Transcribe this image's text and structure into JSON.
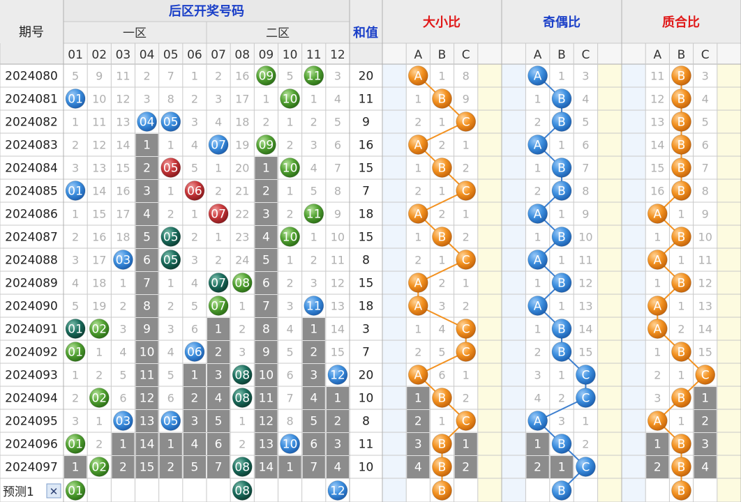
{
  "header": {
    "period_label": "期号",
    "main_title": "后区开奖号码",
    "zone1_label": "一区",
    "zone2_label": "二区",
    "sum_label": "和值",
    "big_small_label": "大小比",
    "odd_even_label": "奇偶比",
    "prime_comp_label": "质合比",
    "sub_cols": [
      "A",
      "B",
      "C"
    ],
    "numbers": [
      "01",
      "02",
      "03",
      "04",
      "05",
      "06",
      "07",
      "08",
      "09",
      "10",
      "11",
      "12"
    ]
  },
  "predict": {
    "label": "预测1",
    "close_glyph": "✕"
  },
  "colors": {
    "blue_ball": "#3d8fdf",
    "red_ball": "#c8373a",
    "green_ball": "#52a232",
    "teal_ball": "#1b6e5e",
    "orange_ball": "#f39221",
    "gray_cell": "#8c8c8c",
    "header_text": "#1a3fc8",
    "red_header_text": "#e01818",
    "blue_line": "#3d7fcf",
    "orange_line": "#f39221"
  },
  "chart_data": {
    "type": "table",
    "periods": [
      "2024080",
      "2024081",
      "2024082",
      "2024083",
      "2024084",
      "2024085",
      "2024086",
      "2024087",
      "2024088",
      "2024089",
      "2024090",
      "2024091",
      "2024092",
      "2024093",
      "2024094",
      "2024095",
      "2024096",
      "2024097"
    ],
    "cells": [
      [
        "5",
        "9",
        "11",
        "2",
        "7",
        "1",
        "2",
        "16",
        "09",
        "5",
        "11",
        "3"
      ],
      [
        "01",
        "10",
        "12",
        "3",
        "8",
        "2",
        "3",
        "17",
        "1",
        "10",
        "1",
        "4"
      ],
      [
        "1",
        "11",
        "13",
        "04",
        "05",
        "3",
        "4",
        "18",
        "2",
        "1",
        "2",
        "5"
      ],
      [
        "2",
        "12",
        "14",
        "1",
        "1",
        "4",
        "07",
        "19",
        "09",
        "2",
        "3",
        "6"
      ],
      [
        "3",
        "13",
        "15",
        "2",
        "05",
        "5",
        "1",
        "20",
        "1",
        "10",
        "4",
        "7"
      ],
      [
        "01",
        "14",
        "16",
        "3",
        "1",
        "06",
        "2",
        "21",
        "2",
        "1",
        "5",
        "8"
      ],
      [
        "1",
        "15",
        "17",
        "4",
        "2",
        "1",
        "07",
        "22",
        "3",
        "2",
        "11",
        "9"
      ],
      [
        "2",
        "16",
        "18",
        "5",
        "05",
        "2",
        "1",
        "23",
        "4",
        "10",
        "1",
        "10"
      ],
      [
        "3",
        "17",
        "03",
        "6",
        "05",
        "3",
        "2",
        "24",
        "5",
        "1",
        "2",
        "11"
      ],
      [
        "4",
        "18",
        "1",
        "7",
        "1",
        "4",
        "07",
        "08",
        "6",
        "2",
        "3",
        "12"
      ],
      [
        "5",
        "19",
        "2",
        "8",
        "2",
        "5",
        "07",
        "1",
        "7",
        "3",
        "11",
        "13"
      ],
      [
        "01",
        "02",
        "3",
        "9",
        "3",
        "6",
        "1",
        "2",
        "8",
        "4",
        "1",
        "14"
      ],
      [
        "01",
        "1",
        "4",
        "10",
        "4",
        "06",
        "2",
        "3",
        "9",
        "5",
        "2",
        "15"
      ],
      [
        "1",
        "2",
        "5",
        "11",
        "5",
        "1",
        "3",
        "08",
        "10",
        "6",
        "3",
        "12"
      ],
      [
        "2",
        "02",
        "6",
        "12",
        "6",
        "2",
        "4",
        "08",
        "11",
        "7",
        "4",
        "1"
      ],
      [
        "3",
        "1",
        "03",
        "13",
        "05",
        "3",
        "5",
        "1",
        "12",
        "8",
        "5",
        "2"
      ],
      [
        "01",
        "2",
        "1",
        "14",
        "1",
        "4",
        "6",
        "2",
        "13",
        "10",
        "6",
        "3"
      ],
      [
        "1",
        "02",
        "2",
        "15",
        "2",
        "5",
        "7",
        "08",
        "14",
        "1",
        "7",
        "4"
      ]
    ],
    "styles": [
      [
        "n",
        "n",
        "n",
        "n",
        "n",
        "n",
        "n",
        "n",
        "G",
        "n",
        "G",
        "n"
      ],
      [
        "B",
        "n",
        "n",
        "n",
        "n",
        "n",
        "n",
        "n",
        "n",
        "G",
        "n",
        "n"
      ],
      [
        "n",
        "n",
        "n",
        "B",
        "B",
        "n",
        "n",
        "n",
        "n",
        "n",
        "n",
        "n"
      ],
      [
        "n",
        "n",
        "n",
        "g",
        "n",
        "n",
        "B",
        "n",
        "G",
        "n",
        "n",
        "n"
      ],
      [
        "n",
        "n",
        "n",
        "g",
        "R",
        "n",
        "n",
        "n",
        "g",
        "G",
        "n",
        "n"
      ],
      [
        "B",
        "n",
        "n",
        "g",
        "n",
        "R",
        "n",
        "n",
        "g",
        "n",
        "n",
        "n"
      ],
      [
        "n",
        "n",
        "n",
        "g",
        "n",
        "n",
        "R",
        "n",
        "g",
        "n",
        "G",
        "n"
      ],
      [
        "n",
        "n",
        "n",
        "g",
        "T",
        "n",
        "n",
        "n",
        "g",
        "G",
        "n",
        "n"
      ],
      [
        "n",
        "n",
        "B",
        "g",
        "T",
        "n",
        "n",
        "n",
        "g",
        "n",
        "n",
        "n"
      ],
      [
        "n",
        "n",
        "n",
        "g",
        "n",
        "n",
        "T",
        "G",
        "g",
        "n",
        "n",
        "n"
      ],
      [
        "n",
        "n",
        "n",
        "g",
        "n",
        "n",
        "G",
        "n",
        "g",
        "n",
        "B",
        "n"
      ],
      [
        "T",
        "G",
        "n",
        "g",
        "n",
        "n",
        "g",
        "n",
        "g",
        "n",
        "g",
        "n"
      ],
      [
        "G",
        "n",
        "n",
        "g",
        "n",
        "B",
        "g",
        "n",
        "g",
        "n",
        "g",
        "n"
      ],
      [
        "n",
        "n",
        "n",
        "g",
        "n",
        "g",
        "g",
        "T",
        "g",
        "n",
        "g",
        "B"
      ],
      [
        "n",
        "G",
        "n",
        "g",
        "n",
        "g",
        "g",
        "T",
        "g",
        "n",
        "g",
        "g"
      ],
      [
        "n",
        "n",
        "B",
        "g",
        "B",
        "g",
        "g",
        "n",
        "g",
        "n",
        "g",
        "g"
      ],
      [
        "G",
        "n",
        "g",
        "g",
        "g",
        "g",
        "g",
        "n",
        "g",
        "B",
        "g",
        "g"
      ],
      [
        "g",
        "G",
        "g",
        "g",
        "g",
        "g",
        "g",
        "T",
        "g",
        "g",
        "g",
        "g"
      ]
    ],
    "sums": [
      "20",
      "11",
      "9",
      "16",
      "15",
      "7",
      "18",
      "15",
      "8",
      "15",
      "18",
      "3",
      "7",
      "20",
      "10",
      "8",
      "11",
      "10"
    ],
    "big_small": [
      [
        "A",
        "1",
        "8"
      ],
      [
        "1",
        "B",
        "9"
      ],
      [
        "2",
        "1",
        "C"
      ],
      [
        "A",
        "2",
        "1"
      ],
      [
        "1",
        "B",
        "2"
      ],
      [
        "2",
        "1",
        "C"
      ],
      [
        "A",
        "2",
        "1"
      ],
      [
        "1",
        "B",
        "2"
      ],
      [
        "2",
        "1",
        "C"
      ],
      [
        "A",
        "2",
        "1"
      ],
      [
        "A",
        "3",
        "2"
      ],
      [
        "1",
        "4",
        "C"
      ],
      [
        "2",
        "5",
        "C"
      ],
      [
        "A",
        "6",
        "1"
      ],
      [
        "1",
        "B",
        "2"
      ],
      [
        "2",
        "1",
        "C"
      ],
      [
        "3",
        "B",
        "1"
      ],
      [
        "4",
        "B",
        "2"
      ]
    ],
    "big_small_pick": [
      0,
      1,
      2,
      0,
      1,
      2,
      0,
      1,
      2,
      0,
      0,
      2,
      2,
      0,
      1,
      2,
      1,
      1
    ],
    "big_small_gray": [
      [],
      [],
      [],
      [],
      [],
      [],
      [],
      [],
      [],
      [],
      [],
      [],
      [],
      [],
      [
        0
      ],
      [
        0
      ],
      [
        0,
        2
      ],
      [
        0,
        2
      ]
    ],
    "odd_even": [
      [
        "A",
        "1",
        "3"
      ],
      [
        "1",
        "B",
        "4"
      ],
      [
        "2",
        "B",
        "5"
      ],
      [
        "A",
        "1",
        "6"
      ],
      [
        "1",
        "B",
        "7"
      ],
      [
        "2",
        "B",
        "8"
      ],
      [
        "A",
        "1",
        "9"
      ],
      [
        "1",
        "B",
        "10"
      ],
      [
        "A",
        "1",
        "11"
      ],
      [
        "1",
        "B",
        "12"
      ],
      [
        "A",
        "1",
        "13"
      ],
      [
        "1",
        "B",
        "14"
      ],
      [
        "2",
        "B",
        "15"
      ],
      [
        "3",
        "1",
        "C"
      ],
      [
        "4",
        "2",
        "C"
      ],
      [
        "A",
        "3",
        "1"
      ],
      [
        "1",
        "B",
        "2"
      ],
      [
        "2",
        "1",
        "C"
      ]
    ],
    "odd_even_pick": [
      0,
      1,
      1,
      0,
      1,
      1,
      0,
      1,
      0,
      1,
      0,
      1,
      1,
      2,
      2,
      0,
      1,
      2
    ],
    "odd_even_gray": [
      [],
      [],
      [],
      [],
      [],
      [],
      [],
      [],
      [],
      [],
      [],
      [],
      [],
      [],
      [],
      [],
      [
        0
      ],
      [
        0,
        1
      ]
    ],
    "prime_comp": [
      [
        "11",
        "B",
        "3"
      ],
      [
        "12",
        "B",
        "4"
      ],
      [
        "13",
        "B",
        "5"
      ],
      [
        "14",
        "B",
        "6"
      ],
      [
        "15",
        "B",
        "7"
      ],
      [
        "16",
        "B",
        "8"
      ],
      [
        "A",
        "1",
        "9"
      ],
      [
        "1",
        "B",
        "10"
      ],
      [
        "A",
        "1",
        "11"
      ],
      [
        "1",
        "B",
        "12"
      ],
      [
        "A",
        "1",
        "13"
      ],
      [
        "A",
        "2",
        "14"
      ],
      [
        "1",
        "B",
        "15"
      ],
      [
        "2",
        "1",
        "C"
      ],
      [
        "3",
        "B",
        "1"
      ],
      [
        "A",
        "1",
        "2"
      ],
      [
        "1",
        "B",
        "3"
      ],
      [
        "2",
        "B",
        "4"
      ]
    ],
    "prime_comp_pick": [
      1,
      1,
      1,
      1,
      1,
      1,
      0,
      1,
      0,
      1,
      0,
      0,
      1,
      2,
      1,
      0,
      1,
      1
    ],
    "prime_comp_gray": [
      [],
      [],
      [],
      [],
      [],
      [],
      [],
      [],
      [],
      [],
      [],
      [],
      [],
      [],
      [
        2
      ],
      [
        2
      ],
      [
        0,
        2
      ],
      [
        0,
        2
      ]
    ],
    "predict_balls": [
      {
        "col": 0,
        "text": "01",
        "style": "G"
      },
      {
        "col": 7,
        "text": "08",
        "style": "T"
      },
      {
        "col": 11,
        "text": "12",
        "style": "B"
      }
    ],
    "predict_marks": {
      "big_small": [
        1,
        "B"
      ],
      "odd_even": [
        1,
        "B"
      ],
      "prime_comp": [
        1,
        "B"
      ]
    }
  }
}
